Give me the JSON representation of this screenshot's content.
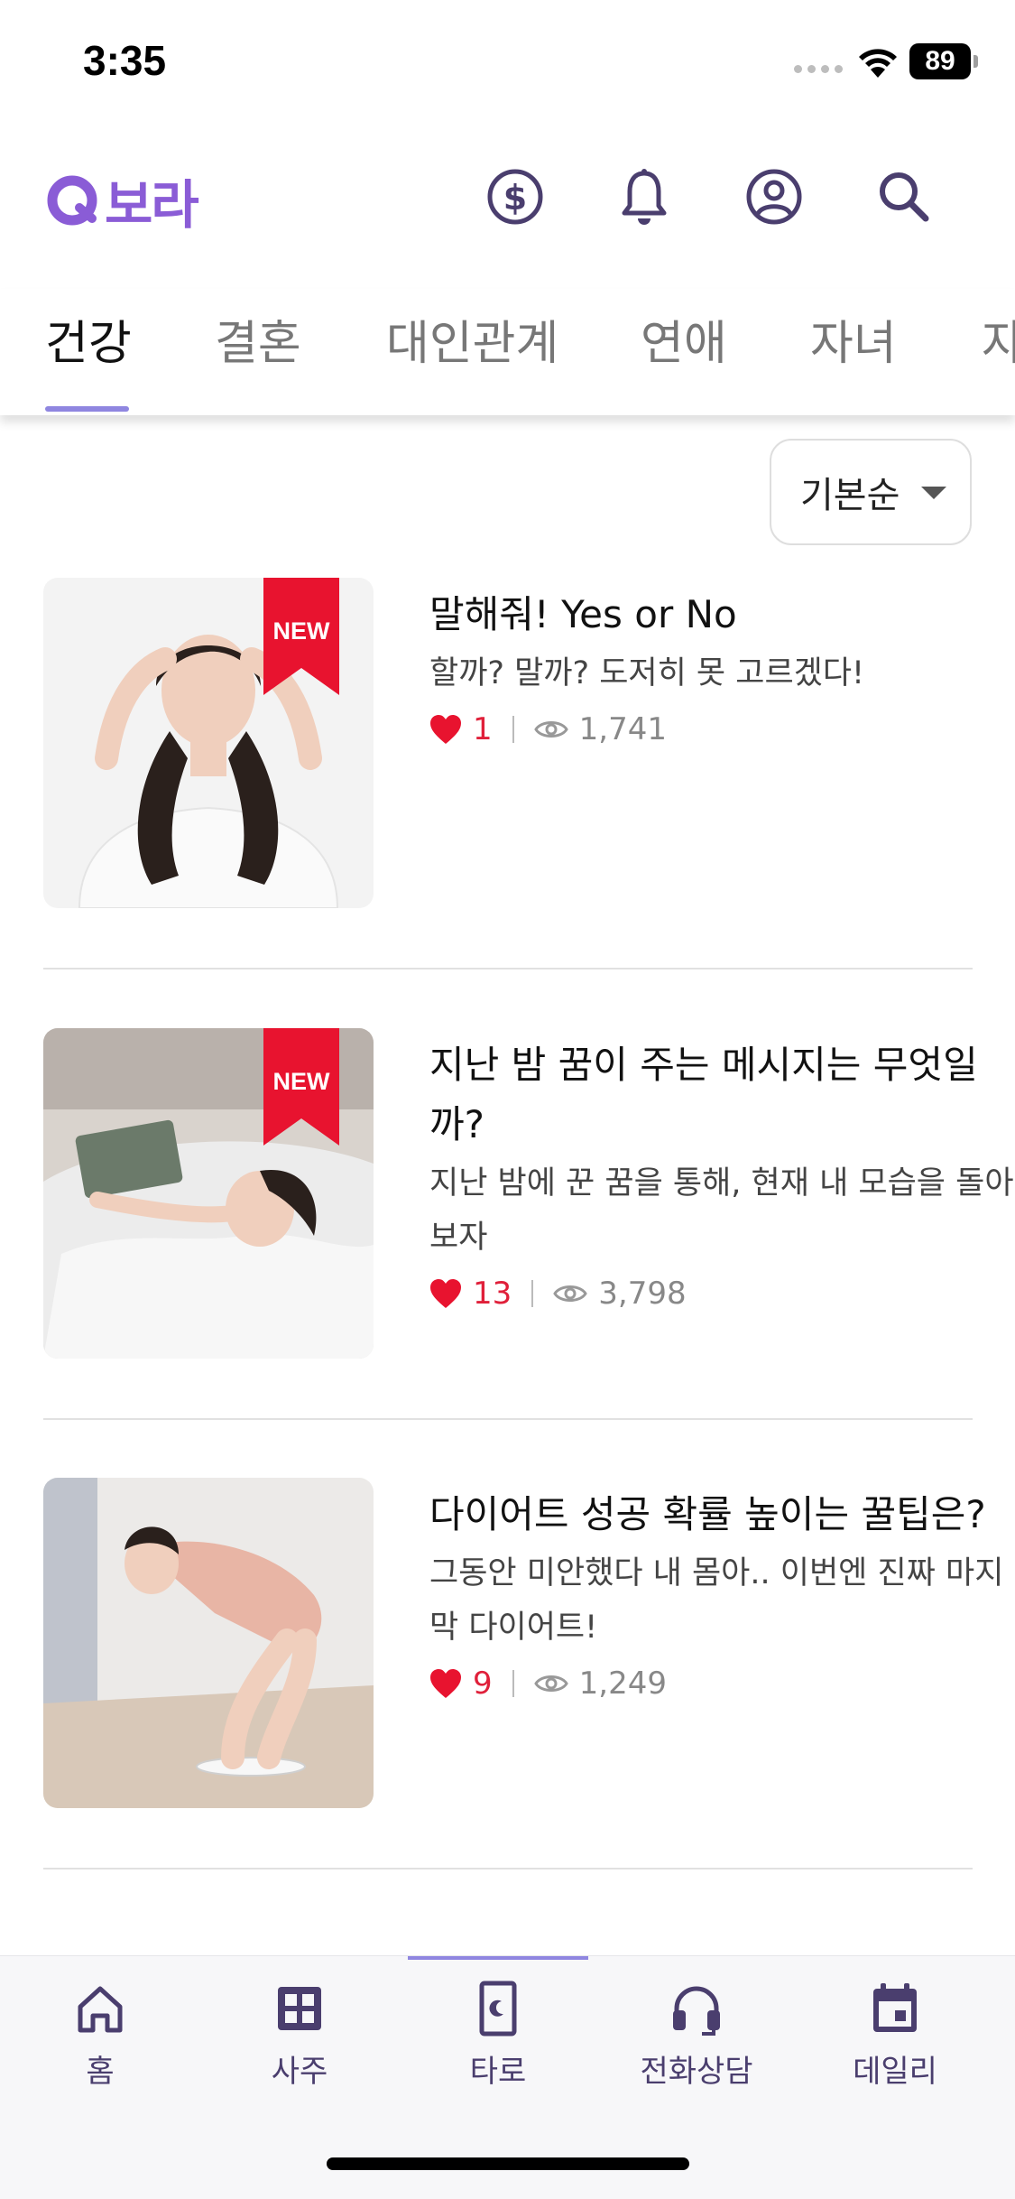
{
  "status_bar": {
    "time": "3:35",
    "battery": "89"
  },
  "header": {
    "logo_text": "보라",
    "icons": [
      "coin-icon",
      "bell-icon",
      "profile-icon",
      "search-icon"
    ]
  },
  "tabs": [
    "건강",
    "결혼",
    "대인관계",
    "연애",
    "자녀",
    "자"
  ],
  "sort": {
    "label": "기본순"
  },
  "items": [
    {
      "title": "말해줘! Yes or No",
      "desc": "할까? 말까? 도저히 못 고르겠다!",
      "likes": "1",
      "views": "1,741",
      "badge": "NEW"
    },
    {
      "title": "지난 밤 꿈이 주는 메시지는 무엇일까?",
      "desc": "지난 밤에 꾼 꿈을 통해, 현재 내 모습을 돌아보자",
      "likes": "13",
      "views": "3,798",
      "badge": "NEW"
    },
    {
      "title": "다이어트 성공 확률 높이는 꿀팁은?",
      "desc": "그동안 미안했다 내 몸아.. 이번엔 진짜 마지막 다이어트!",
      "likes": "9",
      "views": "1,249",
      "badge": ""
    }
  ],
  "bottom_nav": [
    {
      "label": "홈",
      "icon": "home-icon"
    },
    {
      "label": "사주",
      "icon": "grid-icon"
    },
    {
      "label": "타로",
      "icon": "tarot-card-icon"
    },
    {
      "label": "전화상담",
      "icon": "headset-icon"
    },
    {
      "label": "데일리",
      "icon": "calendar-icon"
    }
  ],
  "colors": {
    "accent": "#8a5cd6",
    "nav": "#4a3e6e",
    "like": "#e0203a",
    "tab_indicator": "#8f86e0"
  }
}
